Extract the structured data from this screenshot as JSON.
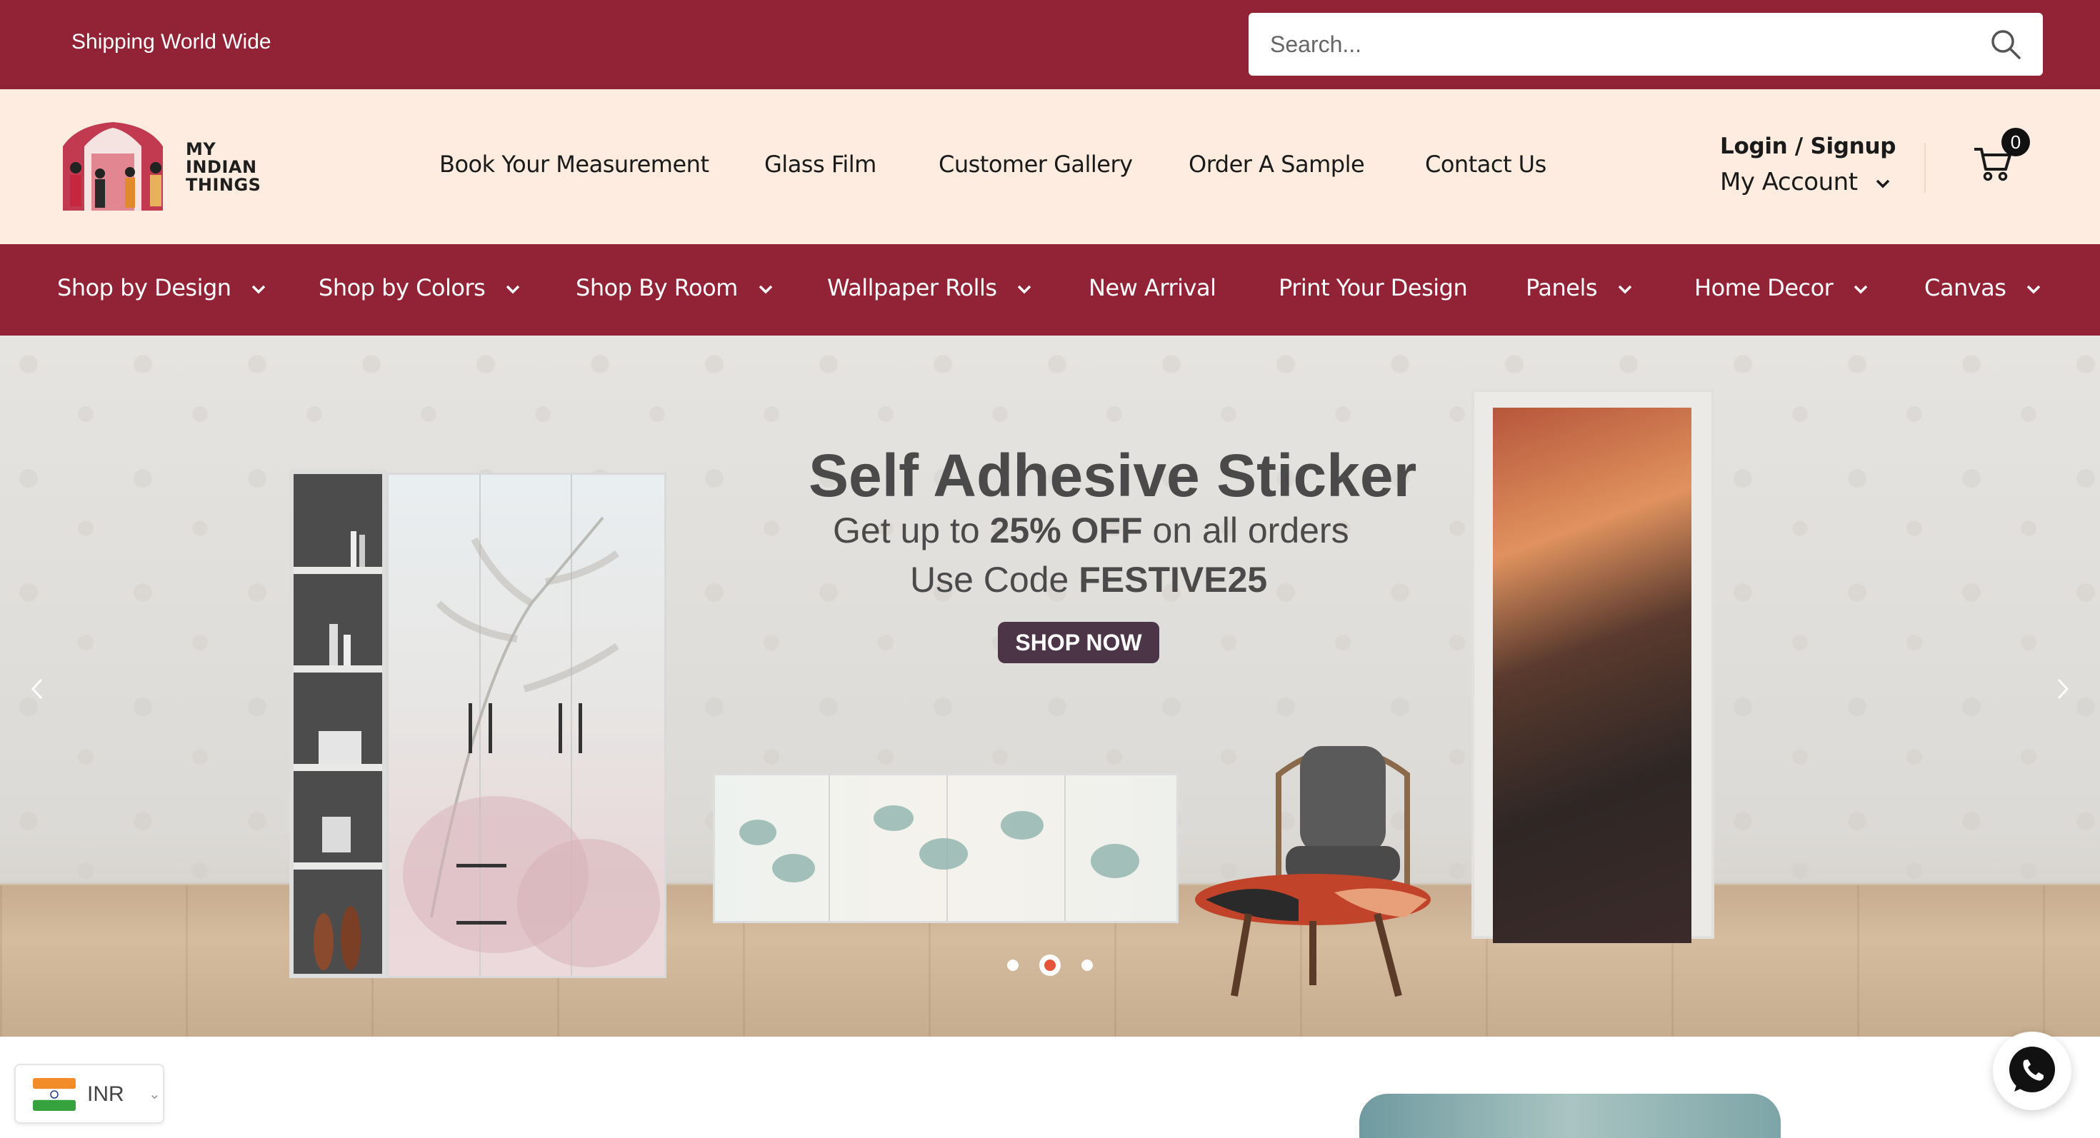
{
  "topbar": {
    "shipping_text": "Shipping World Wide",
    "search_placeholder": "Search...",
    "bg_color": "#922236"
  },
  "header": {
    "logo_text": [
      "MY",
      "INDIAN",
      "THINGS"
    ],
    "nav": [
      "Book Your Measurement",
      "Glass Film",
      "Customer Gallery",
      "Order A Sample",
      "Contact Us"
    ],
    "login_label": "Login / Signup",
    "account_label": "My Account",
    "cart_count": "0",
    "bg_color": "#fdecdf"
  },
  "category_nav": {
    "items": [
      {
        "label": "Shop by Design",
        "dropdown": true
      },
      {
        "label": "Shop by Colors",
        "dropdown": true
      },
      {
        "label": "Shop By Room",
        "dropdown": true
      },
      {
        "label": "Wallpaper Rolls",
        "dropdown": true
      },
      {
        "label": "New Arrival",
        "dropdown": false
      },
      {
        "label": "Print Your Design",
        "dropdown": false
      },
      {
        "label": "Panels",
        "dropdown": true
      },
      {
        "label": "Home Decor",
        "dropdown": true
      },
      {
        "label": "Canvas",
        "dropdown": true
      }
    ]
  },
  "hero": {
    "headline": "Self Adhesive Sticker",
    "promo_prefix": "Get up to ",
    "promo_strong": "25% OFF",
    "promo_suffix": " on all orders",
    "code_prefix": "Use Code ",
    "code_strong": "FESTIVE25",
    "cta": "SHOP NOW",
    "slide_count": 3,
    "active_slide": 2,
    "accent_color": "#e8543a"
  },
  "footer_widgets": {
    "currency_code": "INR",
    "whatsapp_icon": "whatsapp-icon"
  }
}
